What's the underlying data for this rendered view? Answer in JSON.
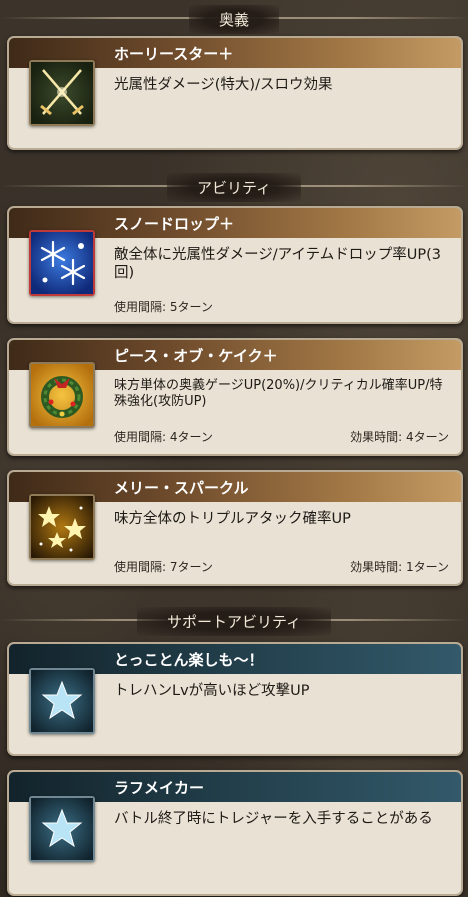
{
  "sections": {
    "ougi": "奥義",
    "abilities": "アビリティ",
    "support": "サポートアビリティ"
  },
  "ougi": {
    "name": "ホーリースター＋",
    "description": "光属性ダメージ(特大)/スロウ効果",
    "icon": "crossed-swords-icon"
  },
  "abilities": [
    {
      "name": "スノードロップ＋",
      "description": "敵全体に光属性ダメージ/アイテムドロップ率UP(3回)",
      "cooldown": "使用間隔: 5ターン",
      "duration": "",
      "icon": "snowflake-icon"
    },
    {
      "name": "ピース・オブ・ケイク＋",
      "description": "味方単体の奥義ゲージUP(20%)/クリティカル確率UP/特殊強化(攻防UP)",
      "cooldown": "使用間隔: 4ターン",
      "duration": "効果時間: 4ターン",
      "icon": "wreath-icon"
    },
    {
      "name": "メリー・スパークル",
      "description": "味方全体のトリプルアタック確率UP",
      "cooldown": "使用間隔: 7ターン",
      "duration": "効果時間: 1ターン",
      "icon": "sparkle-stars-icon"
    }
  ],
  "support": [
    {
      "name": "とっことん楽しも〜！",
      "description": "トレハンLvが高いほど攻撃UP",
      "icon": "star-icon"
    },
    {
      "name": "ラフメイカー",
      "description": "バトル終了時にトレジャーを入手することがある",
      "icon": "star-icon"
    }
  ]
}
